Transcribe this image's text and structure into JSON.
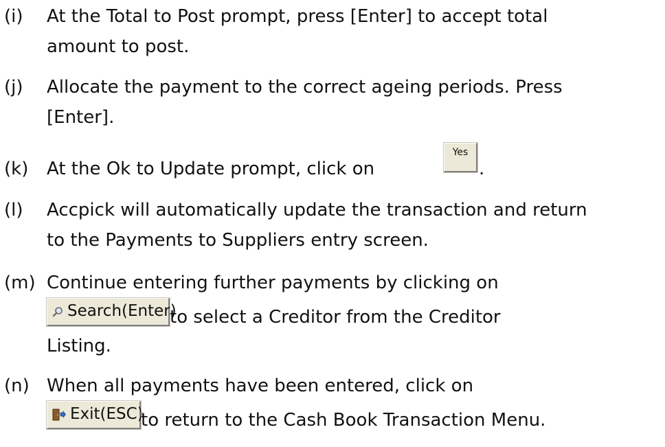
{
  "steps": {
    "i": {
      "marker": "(i)",
      "line1": "At the Total to Post prompt, press [Enter] to accept total",
      "line2": "amount to post."
    },
    "j": {
      "marker": "(j)",
      "line1": "Allocate the payment to the correct ageing periods. Press",
      "line2": "[Enter]."
    },
    "k": {
      "marker": "(k)",
      "before": "At the Ok to Update prompt, click on ",
      "button_label": "Yes",
      "after": "."
    },
    "l": {
      "marker": "(l)",
      "line1": "Accpick will automatically update the transaction and return",
      "line2": "to the Payments to Suppliers entry screen."
    },
    "m": {
      "marker": "(m)",
      "line1": "Continue entering further payments by clicking on",
      "button_label": "Search(Enter)",
      "after": " to select a Creditor from the Creditor",
      "line3": "Listing."
    },
    "n": {
      "marker": "(n)",
      "line1": "When all payments have been entered, click on",
      "button_label": "Exit(ESC)",
      "after": " to return to the Cash Book Transaction Menu."
    }
  },
  "icons": {
    "search": "magnifier-icon",
    "exit": "exit-door-icon"
  },
  "colors": {
    "text": "#111111",
    "button_face": "#ece9d8",
    "button_shadow": "#808080"
  }
}
